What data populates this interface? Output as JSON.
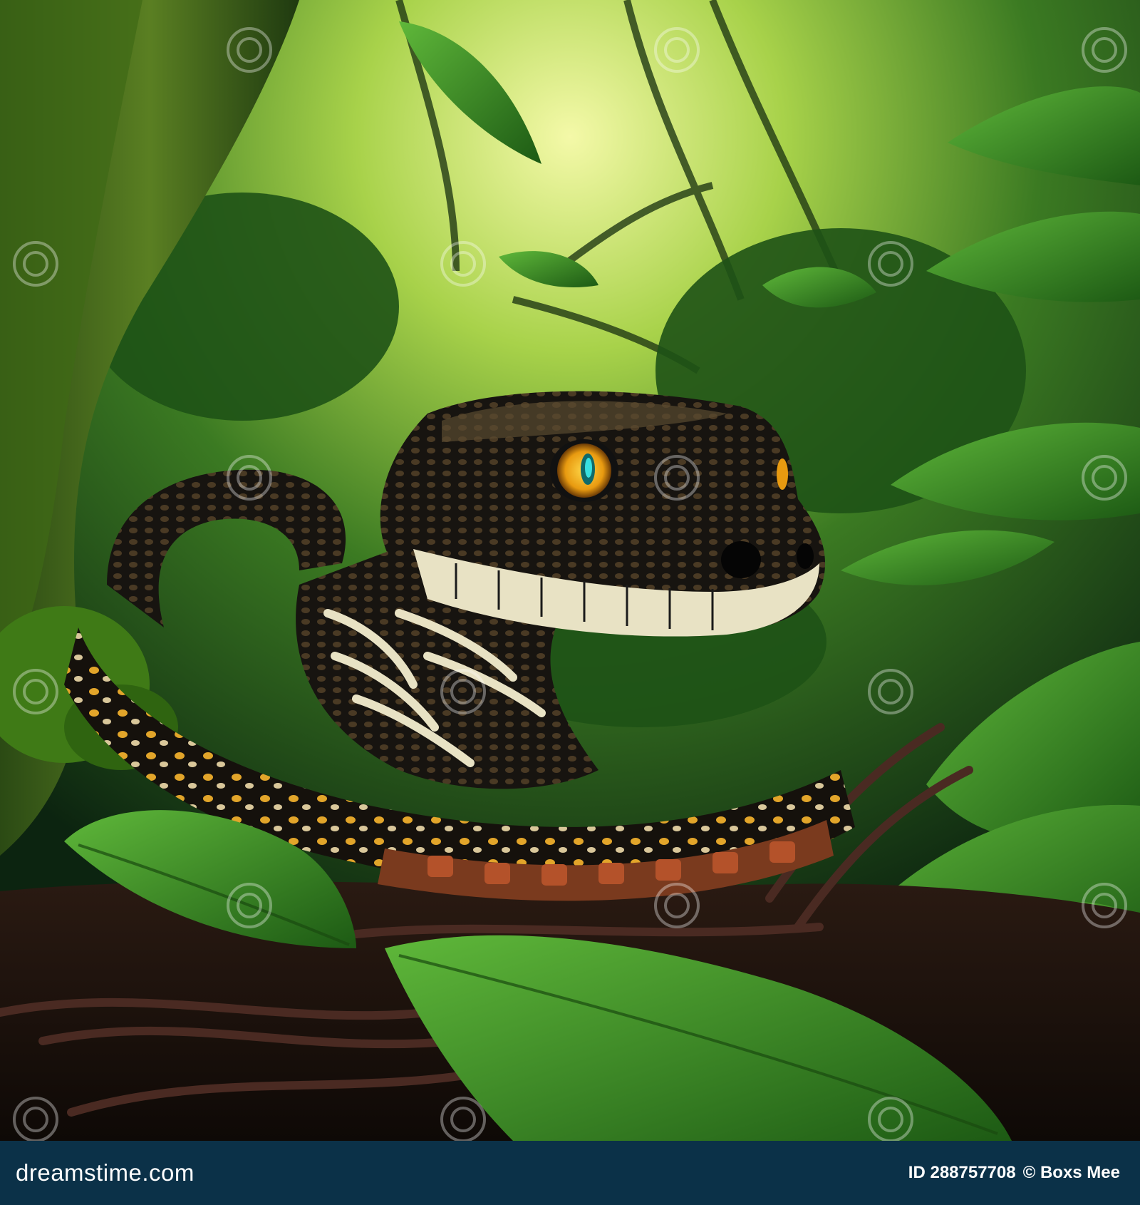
{
  "image": {
    "subject": "snake in jungle",
    "watermark_text": "dreamstime",
    "colors": {
      "jungle_dark": "#0d2a12",
      "jungle_mid": "#2e6b1f",
      "light_glow": "#d9f27a",
      "snake_dark": "#1a1a1a",
      "snake_cream": "#e8e2c4",
      "snake_orange": "#e08a1e",
      "eye_yellow": "#f2b31a",
      "footer_bg": "#0b3148"
    }
  },
  "footer": {
    "brand": "dreamstime.com",
    "image_id": "ID 288757708",
    "author": "© Boxs Mee"
  }
}
